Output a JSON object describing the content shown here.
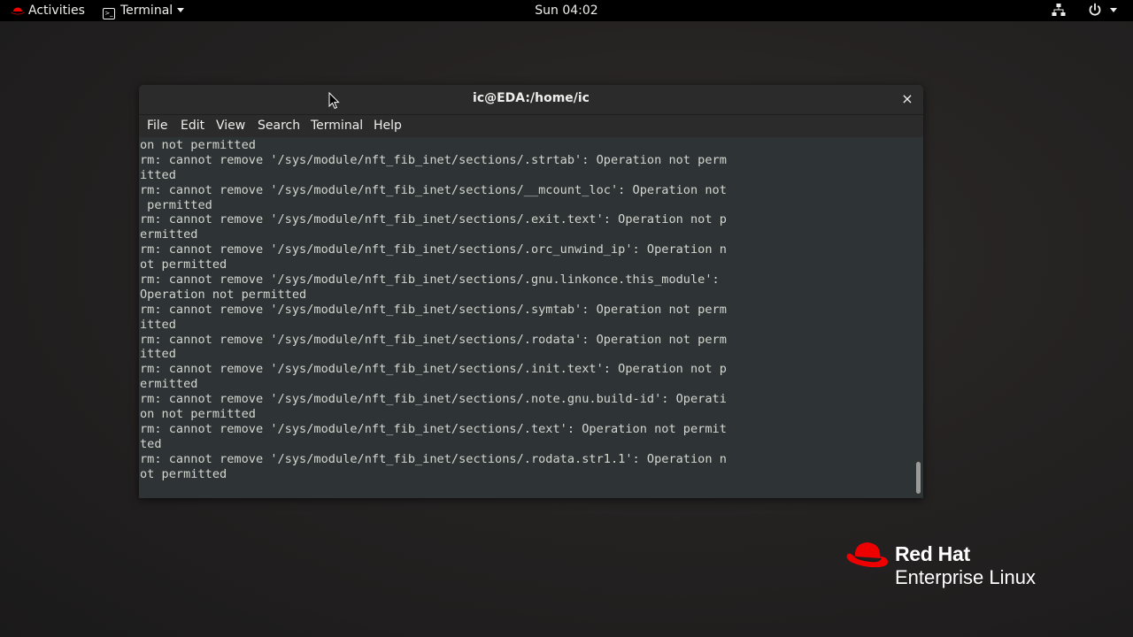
{
  "topbar": {
    "activities_label": "Activities",
    "app_menu_label": "Terminal",
    "clock": "Sun 04:02",
    "icons": [
      "redhat-icon",
      "terminal-icon",
      "chevron-down-icon",
      "network-icon",
      "power-icon",
      "chevron-down-icon"
    ]
  },
  "window": {
    "title": "ic@EDA:/home/ic",
    "close_glyph": "×",
    "menu": [
      {
        "label": "File"
      },
      {
        "label": "Edit"
      },
      {
        "label": "View"
      },
      {
        "label": "Search"
      },
      {
        "label": "Terminal"
      },
      {
        "label": "Help"
      }
    ],
    "terminal_lines": [
      "on not permitted",
      "rm: cannot remove '/sys/module/nft_fib_inet/sections/.strtab': Operation not perm",
      "itted",
      "rm: cannot remove '/sys/module/nft_fib_inet/sections/__mcount_loc': Operation not",
      " permitted",
      "rm: cannot remove '/sys/module/nft_fib_inet/sections/.exit.text': Operation not p",
      "ermitted",
      "rm: cannot remove '/sys/module/nft_fib_inet/sections/.orc_unwind_ip': Operation n",
      "ot permitted",
      "rm: cannot remove '/sys/module/nft_fib_inet/sections/.gnu.linkonce.this_module':",
      "Operation not permitted",
      "rm: cannot remove '/sys/module/nft_fib_inet/sections/.symtab': Operation not perm",
      "itted",
      "rm: cannot remove '/sys/module/nft_fib_inet/sections/.rodata': Operation not perm",
      "itted",
      "rm: cannot remove '/sys/module/nft_fib_inet/sections/.init.text': Operation not p",
      "ermitted",
      "rm: cannot remove '/sys/module/nft_fib_inet/sections/.note.gnu.build-id': Operati",
      "on not permitted",
      "rm: cannot remove '/sys/module/nft_fib_inet/sections/.text': Operation not permit",
      "ted",
      "rm: cannot remove '/sys/module/nft_fib_inet/sections/.rodata.str1.1': Operation n",
      "ot permitted"
    ],
    "scroll_position": 1.0
  },
  "branding": {
    "name": "Red Hat",
    "product": "Enterprise Linux"
  },
  "colors": {
    "redhat_red": "#ee0000",
    "terminal_bg": "#2e3436",
    "terminal_fg": "#d3d7cf"
  }
}
